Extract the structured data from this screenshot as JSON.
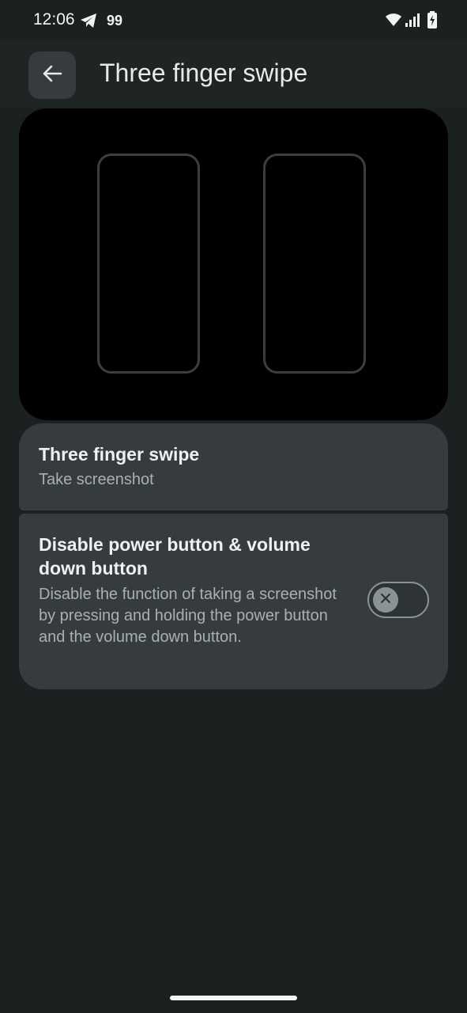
{
  "status_bar": {
    "time": "12:06",
    "notification_count": "99",
    "icons": [
      "telegram-icon",
      "wifi-icon",
      "signal-icon",
      "battery-charging-icon"
    ]
  },
  "app_bar": {
    "back_icon": "arrow-back-icon",
    "title": "Three finger swipe"
  },
  "preview": {
    "illustration": "two-phone-outlines"
  },
  "settings": {
    "gesture": {
      "title": "Three finger swipe",
      "summary": "Take screenshot"
    },
    "disable_power_volume": {
      "title": "Disable power button & volume down button",
      "summary": "Disable the function of taking a screenshot by pressing and holding the power button and the volume down button.",
      "enabled": false,
      "toggle_icon": "close-icon"
    }
  },
  "colors": {
    "background": "#1b2021",
    "card": "#363c3d",
    "preview": "#000000",
    "toggle_outline": "#8b9293"
  }
}
